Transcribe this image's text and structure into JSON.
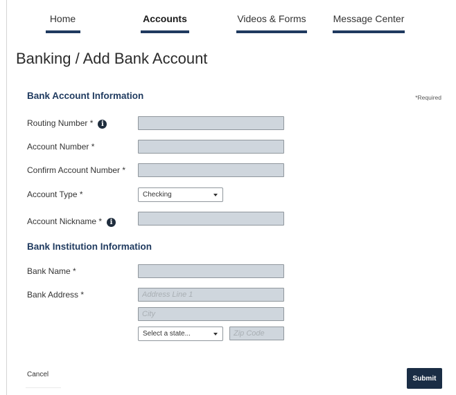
{
  "nav": {
    "items": [
      {
        "label": "Home"
      },
      {
        "label": "Accounts"
      },
      {
        "label": "Videos & Forms"
      },
      {
        "label": "Message Center"
      }
    ],
    "active": "Accounts"
  },
  "page_title": "Banking / Add Bank Account",
  "bank_account_section": {
    "title": "Bank Account Information",
    "required_note": "*Required",
    "routing_number_label": "Routing Number *",
    "account_number_label": "Account Number *",
    "confirm_account_number_label": "Confirm Account Number *",
    "account_type_label": "Account Type *",
    "account_type_value": "Checking",
    "account_nickname_label": "Account Nickname *",
    "info_icon_glyph": "i"
  },
  "bank_institution_section": {
    "title": "Bank Institution Information",
    "bank_name_label": "Bank Name *",
    "bank_address_label": "Bank Address *",
    "address_line_1_placeholder": "Address Line 1",
    "city_placeholder": "City",
    "state_value": "Select a state...",
    "zip_placeholder": "Zip Code"
  },
  "actions": {
    "cancel_label": "Cancel",
    "submit_label": "Submit"
  },
  "colors": {
    "accent": "#1f3a5f",
    "input_bg": "#cfd6dd",
    "submit_bg": "#1a2d45"
  }
}
